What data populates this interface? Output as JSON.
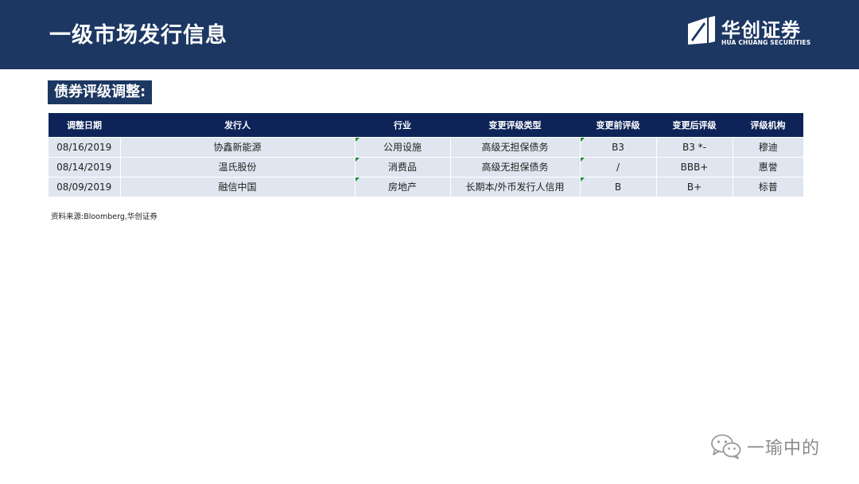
{
  "header": {
    "title": "一级市场发行信息",
    "logo_cn": "华创证券",
    "logo_en": "HUA CHUANG SECURITIES"
  },
  "section": {
    "title": "债券评级调整:"
  },
  "table": {
    "columns": [
      "调整日期",
      "发行人",
      "行业",
      "变更评级类型",
      "变更前评级",
      "变更后评级",
      "评级机构"
    ],
    "rows": [
      [
        "08/16/2019",
        "协鑫新能源",
        "公用设施",
        "高级无担保债务",
        "B3",
        "B3 *-",
        "穆迪"
      ],
      [
        "08/14/2019",
        "温氏股份",
        "消费品",
        "高级无担保债务",
        "/",
        "BBB+",
        "惠誉"
      ],
      [
        "08/09/2019",
        "融信中国",
        "房地产",
        "长期本/外币发行人信用",
        "B",
        "B+",
        "标普"
      ]
    ]
  },
  "footer": {
    "source": "资料来源:Bloomberg,华创证券"
  },
  "watermark": {
    "text": "一瑜中的",
    "icon": "wechat-icon"
  },
  "colors": {
    "header_bg": "#1c3762",
    "table_header_bg": "#0e2459",
    "row_bg": "#dfe6ef",
    "corner_mark": "#1a8a2a"
  }
}
